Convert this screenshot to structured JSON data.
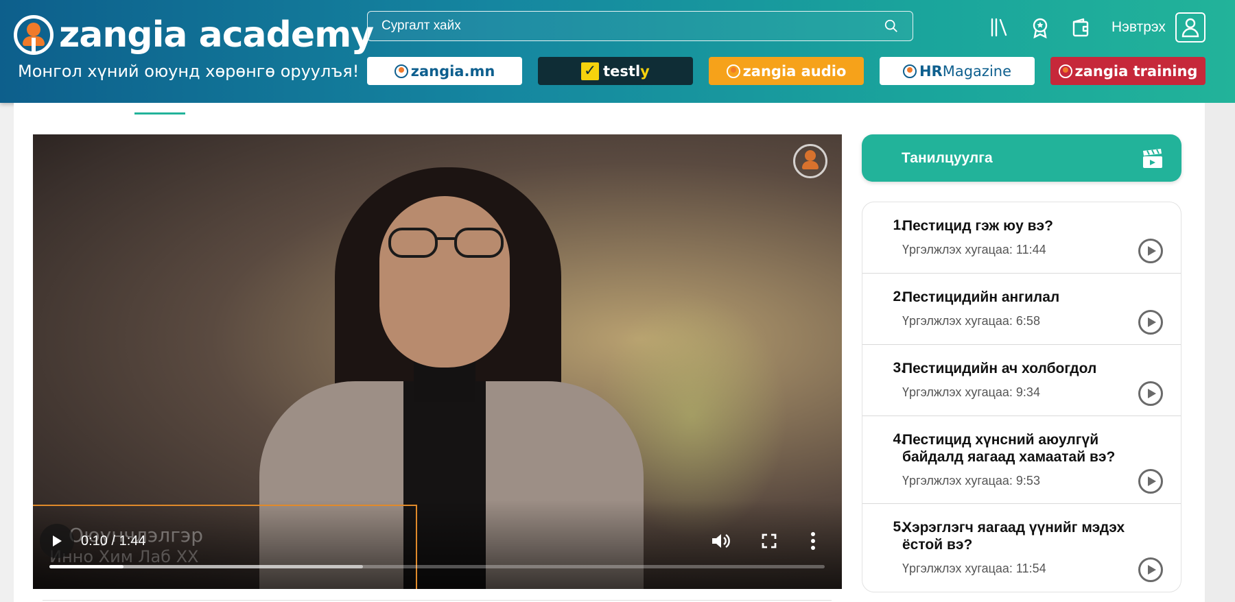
{
  "header": {
    "logo_text": "zangia academy",
    "slogan": "Монгол хүний оюунд хөрөнгө оруулъя!",
    "search_placeholder": "Сургалт хайх",
    "login_label": "Нэвтрэх",
    "brands": [
      {
        "id": "zangia-mn",
        "label": "zangia.mn"
      },
      {
        "id": "testly",
        "label_main": "testl",
        "label_accent": "y"
      },
      {
        "id": "zangia-audio",
        "label": "zangia audio"
      },
      {
        "id": "hr-magazine",
        "label_a": "HR",
        "label_b": "Magazine"
      },
      {
        "id": "zangia-training",
        "label": "zangia training"
      }
    ]
  },
  "video": {
    "time": "0:10 / 1:44",
    "progress_fraction": 0.096,
    "buffered_fraction": 0.404,
    "lower_third_name": "Оюунчлэлгэр",
    "lower_third_org": "Инно Хим Лаб ХХ"
  },
  "sidebar": {
    "intro_label": "Танилцуулга",
    "lessons": [
      {
        "num": "1.",
        "title": "Пестицид гэж юу вэ?",
        "duration": "Үргэлжлэх хугацаа: 11:44"
      },
      {
        "num": "2.",
        "title": "Пестицидийн ангилал",
        "duration": "Үргэлжлэх хугацаа: 6:58"
      },
      {
        "num": "3.",
        "title": "Пестицидийн ач холбогдол",
        "duration": "Үргэлжлэх хугацаа: 9:34"
      },
      {
        "num": "4.",
        "title": "Пестицид хүнсний аюулгүй байдалд яагаад хамаатай вэ?",
        "duration": "Үргэлжлэх хугацаа: 9:53"
      },
      {
        "num": "5.",
        "title": "Хэрэглэгч яагаад үүнийг мэдэх ёстой вэ?",
        "duration": "Үргэлжлэх хугацаа: 11:54"
      }
    ]
  },
  "colors": {
    "accent": "#22b39a",
    "brand_orange": "#f07a2a",
    "header_start": "#0d5f8c"
  },
  "icons": {
    "search": "search-icon",
    "library": "library-icon",
    "badge": "badge-icon",
    "wallet": "wallet-icon",
    "user": "user-icon",
    "clapperboard": "clapperboard-icon",
    "play": "play-icon"
  }
}
